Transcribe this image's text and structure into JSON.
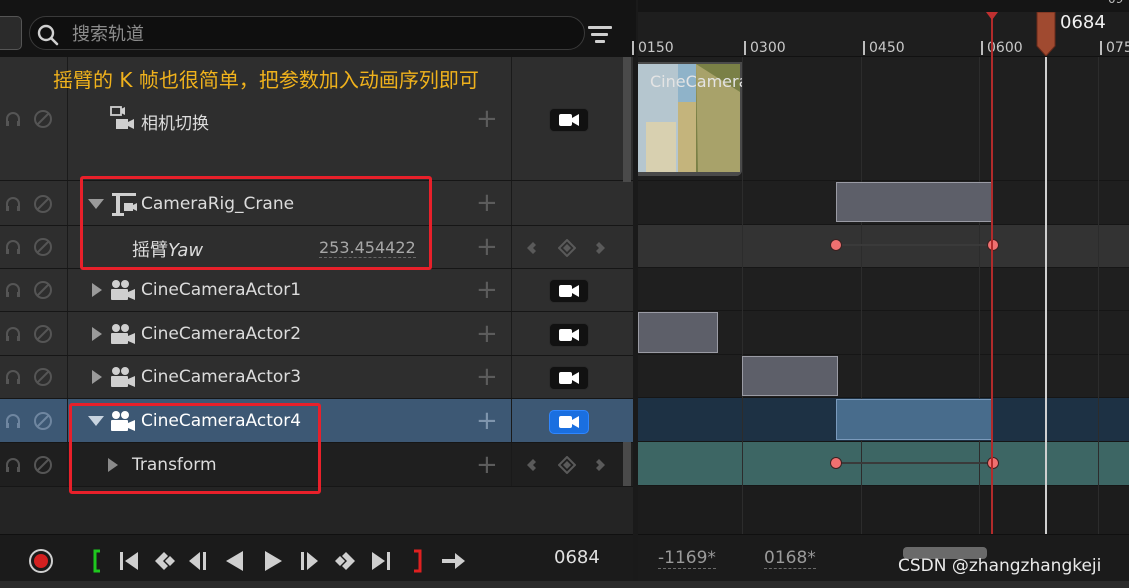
{
  "search": {
    "placeholder": "搜索轨道"
  },
  "annotation": "摇臂的 K 帧也很简单，把参数加入动画序列即可",
  "tracks": [
    {
      "label": "相机切换"
    },
    {
      "label": "CameraRig_Crane"
    },
    {
      "label": "摇臂",
      "label_italic": "Yaw",
      "value": "253.454422"
    },
    {
      "label": "CineCameraActor1"
    },
    {
      "label": "CineCameraActor2"
    },
    {
      "label": "CineCameraActor3"
    },
    {
      "label": "CineCameraActor4"
    },
    {
      "label": "Transform"
    }
  ],
  "transport": {
    "current_frame": "0684"
  },
  "timeline": {
    "ticks": [
      "0150",
      "0300",
      "0450",
      "0600",
      "075"
    ],
    "top_right_partial": "09",
    "playhead_frame": "0684",
    "thumbnail_label": "CineCamera",
    "range_start": "-1169*",
    "range_end": "0168*"
  },
  "watermark": "CSDN @zhangzhangkeji",
  "colors": {
    "accent_blue": "#1a6fe0",
    "selection_row": "#3d5874",
    "annotation": "#f0b21c",
    "highlight_box": "#e8202a",
    "keyframe": "#f07070"
  }
}
